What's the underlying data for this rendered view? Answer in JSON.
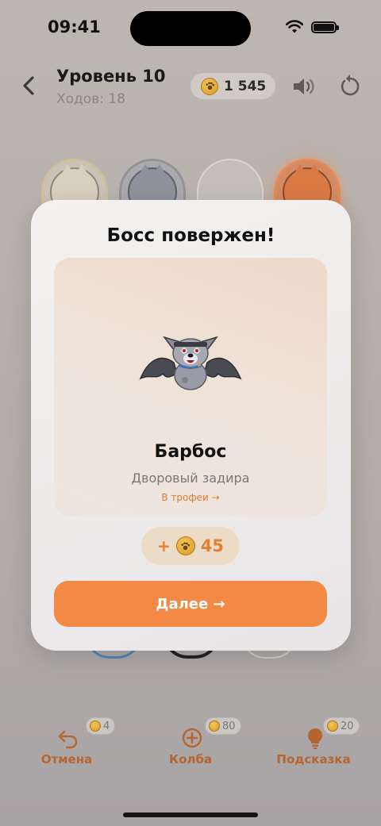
{
  "status_bar": {
    "time": "09:41"
  },
  "header": {
    "title": "Уровень 10",
    "moves": "Ходов: 18",
    "coins": "1 545"
  },
  "toolbar": {
    "undo": {
      "label": "Отмена",
      "cost": "4"
    },
    "flask": {
      "label": "Колба",
      "cost": "80"
    },
    "hint": {
      "label": "Подсказка",
      "cost": "20"
    }
  },
  "modal": {
    "title": "Босс повержен!",
    "boss_name": "Барбос",
    "boss_description": "Дворовый задира",
    "trophy_link": "В трофеи →",
    "reward_sign": "+",
    "reward_amount": "45",
    "next_button": "Далее →"
  },
  "colors": {
    "accent": "#f28a46",
    "reward_text": "#e27e35",
    "toolbar_label": "#b5652f"
  },
  "icons": [
    "back-chevron-icon",
    "paw-coin-icon",
    "speaker-icon",
    "restart-icon",
    "undo-arrow-icon",
    "plus-circle-icon",
    "lightbulb-icon",
    "wifi-icon",
    "battery-icon"
  ]
}
